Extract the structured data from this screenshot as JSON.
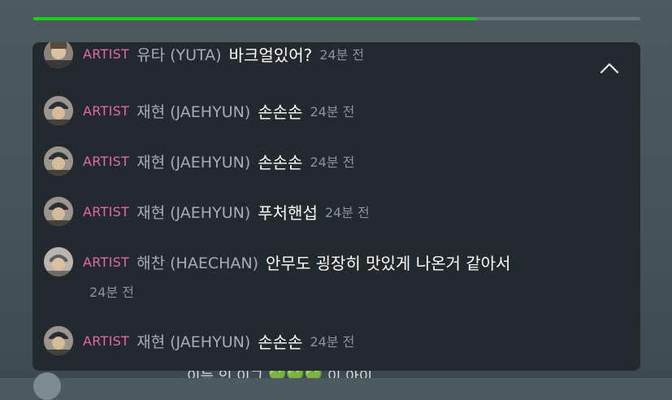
{
  "progress": {
    "fraction": 0.73,
    "color": "#19d21c"
  },
  "chat": {
    "collapse_icon": "chevron-up-icon",
    "messages": [
      {
        "role": "ARTIST",
        "name": "유타 (YUTA)",
        "text": "바크얼있어?",
        "time": "24분 전"
      },
      {
        "role": "ARTIST",
        "name": "재현 (JAEHYUN)",
        "text": "손손손",
        "time": "24분 전"
      },
      {
        "role": "ARTIST",
        "name": "재현 (JAEHYUN)",
        "text": "손손손",
        "time": "24분 전"
      },
      {
        "role": "ARTIST",
        "name": "재현 (JAEHYUN)",
        "text": "푸처핸섭",
        "time": "24분 전"
      },
      {
        "role": "ARTIST",
        "name": "해찬 (HAECHAN)",
        "text": "안무도 굉장히 맛있게 나온거 같아서",
        "time": "24분 전"
      },
      {
        "role": "ARTIST",
        "name": "재현 (JAEHYUN)",
        "text": "손손손",
        "time": "24분 전"
      }
    ]
  },
  "bottom": {
    "text": "이듣 인 이그",
    "hearts": "💚💚💚",
    "tail": "이 아이"
  },
  "colors": {
    "role": "#e06d9b",
    "panel": "#23292d",
    "background": "#4d5a60"
  }
}
